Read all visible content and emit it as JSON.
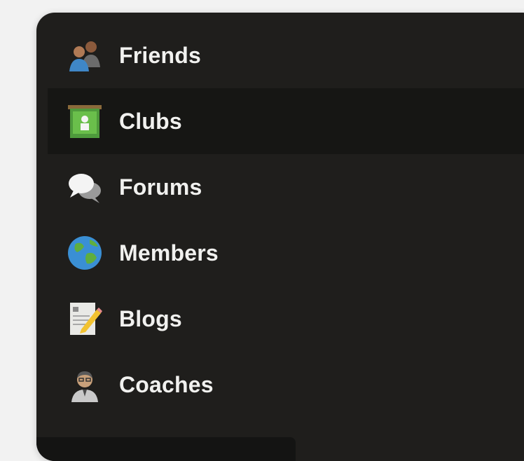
{
  "menu": {
    "items": [
      {
        "label": "Friends",
        "icon": "friends-icon"
      },
      {
        "label": "Clubs",
        "icon": "clubs-icon",
        "selected": true
      },
      {
        "label": "Forums",
        "icon": "forums-icon"
      },
      {
        "label": "Members",
        "icon": "members-globe-icon"
      },
      {
        "label": "Blogs",
        "icon": "blogs-icon"
      },
      {
        "label": "Coaches",
        "icon": "coaches-icon"
      }
    ]
  },
  "colors": {
    "panel_background": "#1f1e1c",
    "selected_row": "#161614",
    "label_text": "#f1f1ef",
    "page_background": "#f2f2f2"
  }
}
